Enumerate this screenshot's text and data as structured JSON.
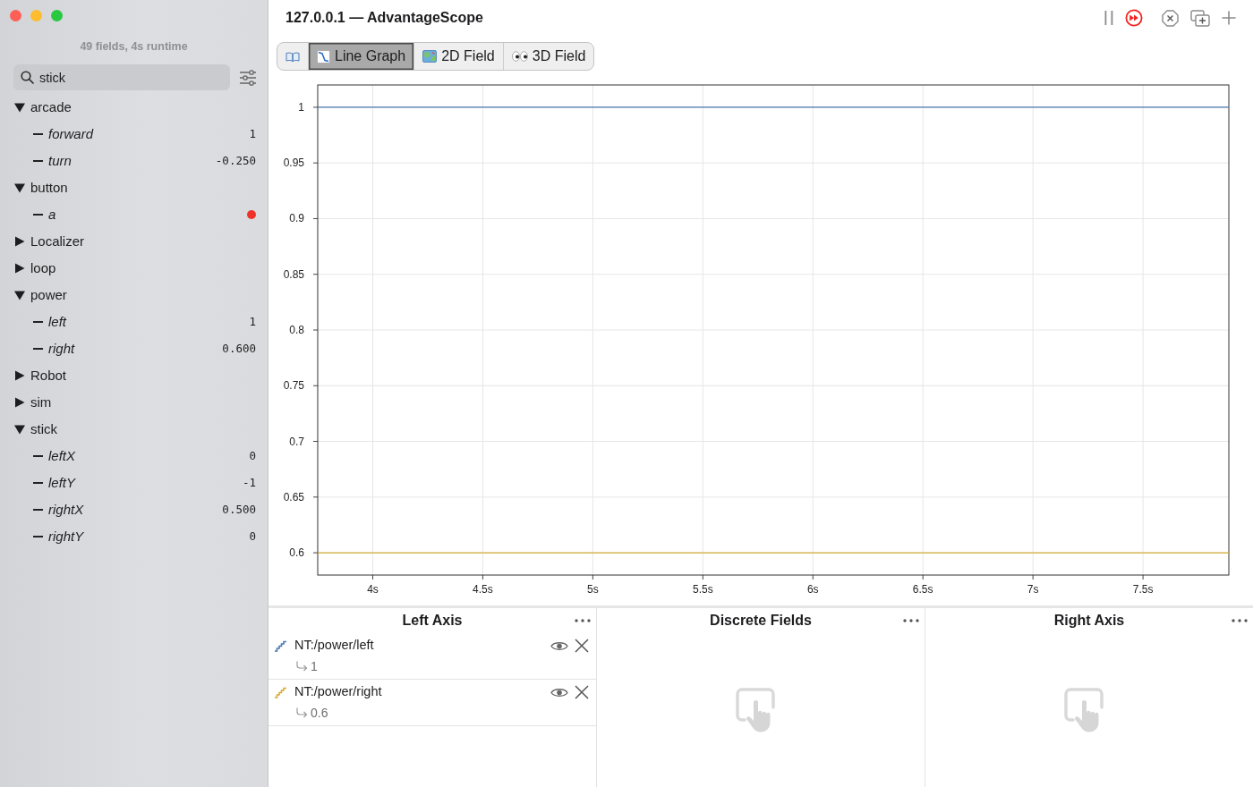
{
  "window": {
    "title": "127.0.0.1 — AdvantageScope"
  },
  "toolbar": {
    "live": true
  },
  "sidebar": {
    "summary": "49 fields, 4s runtime",
    "search": {
      "value": "stick"
    },
    "tree": [
      {
        "label": "arcade",
        "expanded": true,
        "children": [
          {
            "label": "forward",
            "kind": "number",
            "value": "1"
          },
          {
            "label": "turn",
            "kind": "number",
            "value": "-0.250"
          }
        ]
      },
      {
        "label": "button",
        "expanded": true,
        "children": [
          {
            "label": "a",
            "kind": "boolean",
            "on": false
          }
        ]
      },
      {
        "label": "Localizer",
        "expanded": false
      },
      {
        "label": "loop",
        "expanded": false
      },
      {
        "label": "power",
        "expanded": true,
        "children": [
          {
            "label": "left",
            "kind": "number",
            "value": "1"
          },
          {
            "label": "right",
            "kind": "number",
            "value": "0.600"
          }
        ]
      },
      {
        "label": "Robot",
        "expanded": false
      },
      {
        "label": "sim",
        "expanded": false
      },
      {
        "label": "stick",
        "expanded": true,
        "children": [
          {
            "label": "leftX",
            "kind": "number",
            "value": "0"
          },
          {
            "label": "leftY",
            "kind": "number",
            "value": "-1"
          },
          {
            "label": "rightX",
            "kind": "number",
            "value": "0.500"
          },
          {
            "label": "rightY",
            "kind": "number",
            "value": "0"
          }
        ]
      }
    ]
  },
  "tabs": [
    {
      "kind": "docs",
      "selected": false
    },
    {
      "kind": "line-graph",
      "label": "Line Graph",
      "selected": true
    },
    {
      "kind": "field-2d",
      "label": "2D Field",
      "selected": false
    },
    {
      "kind": "field-3d",
      "label": "3D Field",
      "selected": false
    }
  ],
  "chart": {
    "chart_data": {
      "type": "line",
      "grid": true,
      "x": [
        3.75,
        7.89
      ],
      "series": [
        {
          "color": "#4a78b0",
          "values": [
            1,
            1
          ]
        },
        {
          "color": "#d6ac36",
          "values": [
            0.6,
            0.6
          ]
        }
      ],
      "xlim": [
        3.75,
        7.89
      ],
      "ylim": [
        0.58,
        1.02
      ],
      "xticks": [
        {
          "value": 4,
          "label": "4s"
        },
        {
          "value": 4.5,
          "label": "4.5s"
        },
        {
          "value": 5,
          "label": "5s"
        },
        {
          "value": 5.5,
          "label": "5.5s"
        },
        {
          "value": 6,
          "label": "6s"
        },
        {
          "value": 6.5,
          "label": "6.5s"
        },
        {
          "value": 7,
          "label": "7s"
        },
        {
          "value": 7.5,
          "label": "7.5s"
        }
      ],
      "yticks": [
        0.6,
        0.65,
        0.7,
        0.75,
        0.8,
        0.85,
        0.9,
        0.95,
        1
      ]
    }
  },
  "panels": [
    {
      "title": "Left Axis",
      "fields": [
        {
          "name": "NT:/power/left",
          "color": "#4a78b0",
          "value": "1",
          "visible": true
        },
        {
          "name": "NT:/power/right",
          "color": "#d6ac36",
          "value": "0.6",
          "visible": true
        }
      ]
    },
    {
      "title": "Discrete Fields"
    },
    {
      "title": "Right Axis"
    }
  ]
}
